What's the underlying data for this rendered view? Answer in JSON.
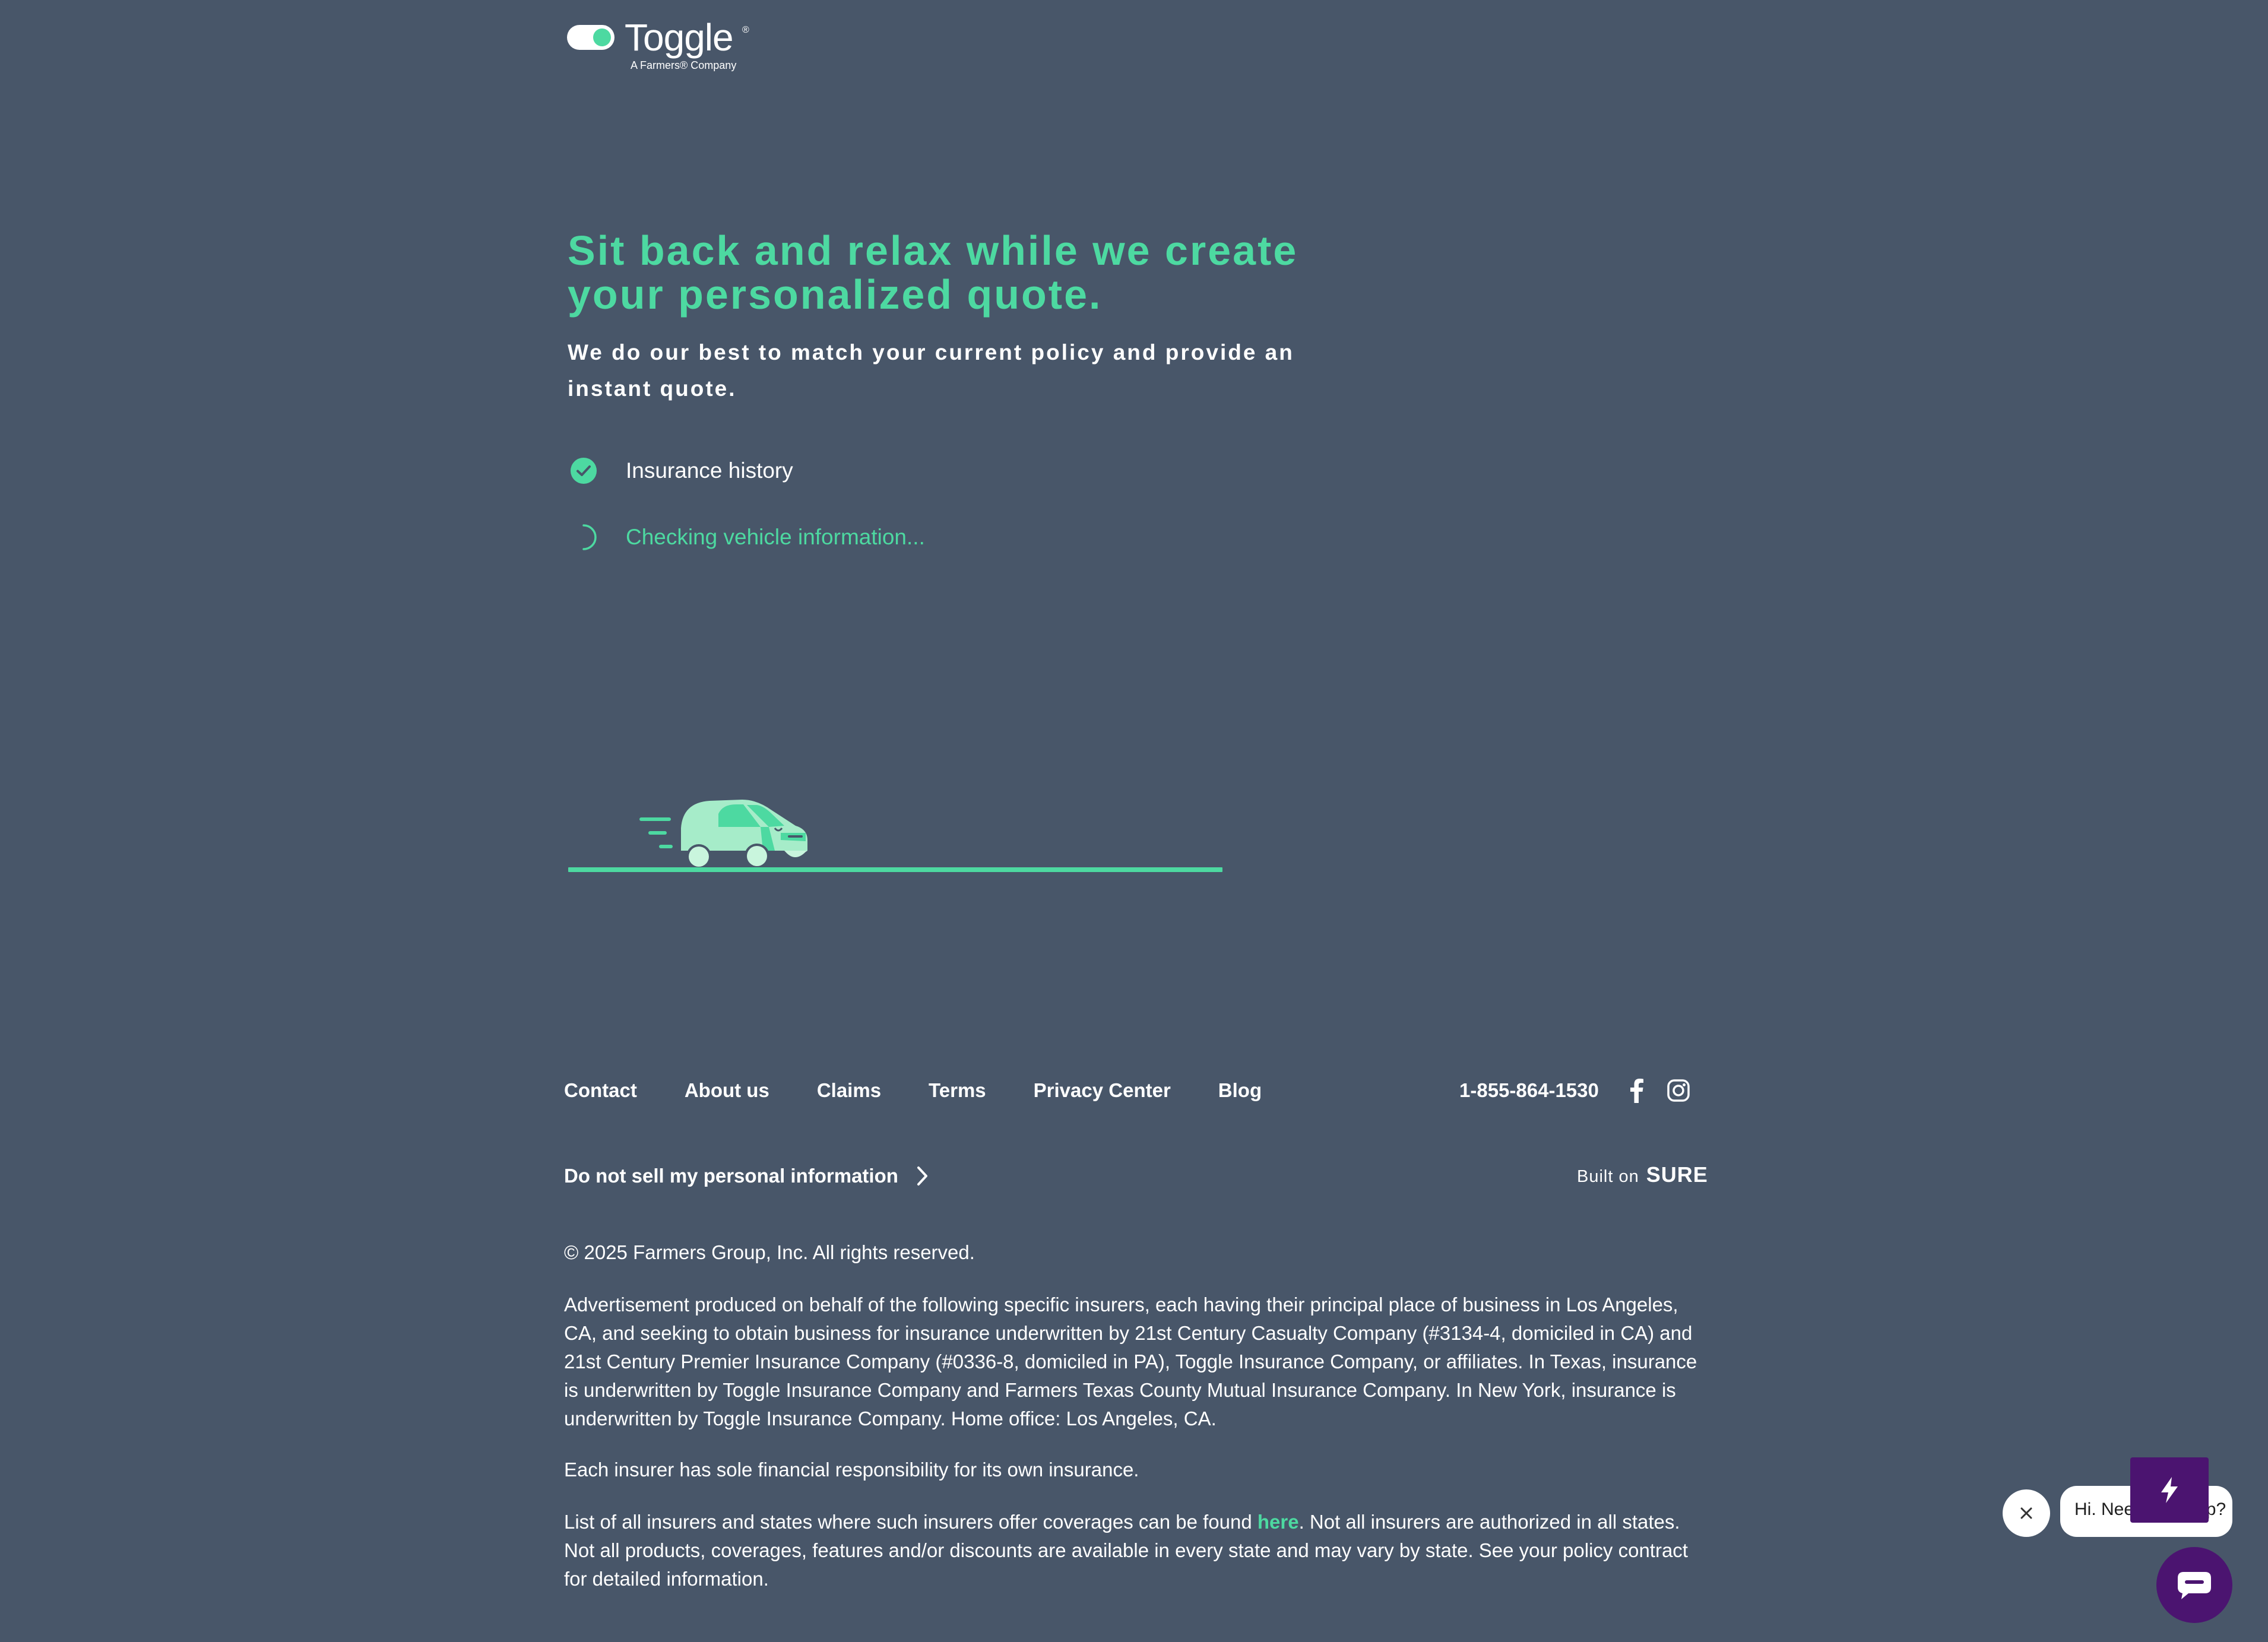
{
  "brand": {
    "name": "Toggle",
    "registered_mark": "®",
    "tagline": "A Farmers® Company",
    "accent_color": "#4dd9a1",
    "background_color": "#485669"
  },
  "main": {
    "headline": "Sit back and relax while we create your personalized quote.",
    "subheadline": "We do our best to match your current policy and provide an instant quote.",
    "steps": [
      {
        "label": "Insurance history",
        "status": "complete",
        "icon": "check-circle-icon"
      },
      {
        "label": "Checking vehicle information...",
        "status": "in-progress",
        "icon": "spinner-icon"
      }
    ],
    "illustration": "car-on-road-illustration"
  },
  "footer": {
    "nav": [
      "Contact",
      "About us",
      "Claims",
      "Terms",
      "Privacy Center",
      "Blog"
    ],
    "phone": "1-855-864-1530",
    "social": [
      "facebook-icon",
      "instagram-icon"
    ],
    "do_not_sell": "Do not sell my personal information",
    "built_on_label": "Built on",
    "built_on_brand": "SURE",
    "copyright": "© 2025 Farmers Group, Inc. All rights reserved.",
    "advertisement": "Advertisement produced on behalf of the following specific insurers, each having their principal place of business in Los Angeles, CA, and seeking to obtain business for insurance underwritten by 21st Century Casualty Company (#3134-4, domiciled in CA) and 21st Century Premier Insurance Company (#0336-8, domiciled in PA), Toggle Insurance Company, or affiliates. In Texas, insurance is underwritten by Toggle Insurance Company and Farmers Texas County Mutual Insurance Company. In New York, insurance is underwritten by Toggle Insurance Company. Home office: Los Angeles, CA.",
    "sole_responsibility": "Each insurer has sole financial responsibility for its own insurance.",
    "list_before": "List of all insurers and states where such insurers offer coverages can be found ",
    "list_link": "here",
    "list_after": ". Not all insurers are authorized in all states. Not all products, coverages, features and/or discounts are available in every state and may vary by state. See your policy contract for detailed information."
  },
  "chat": {
    "bubble_text": "Hi. Need any help?",
    "brand_color": "#4b1470"
  }
}
